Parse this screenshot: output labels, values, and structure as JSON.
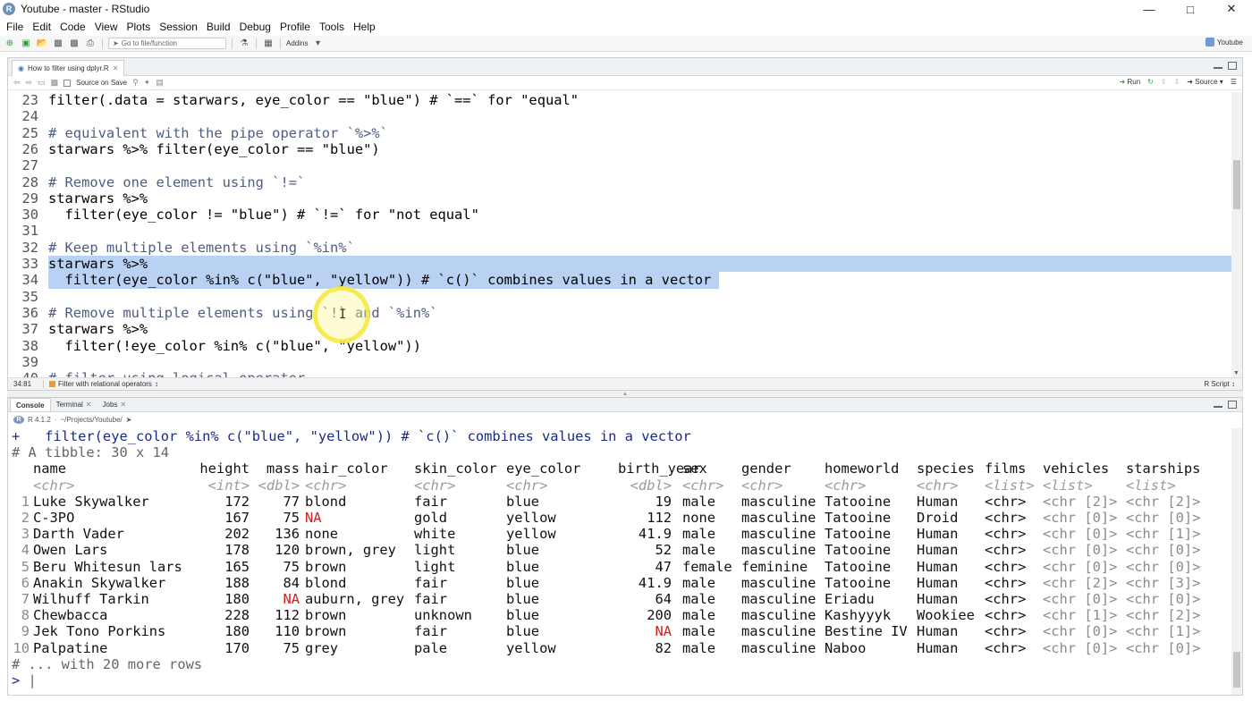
{
  "window": {
    "title": "Youtube - master - RStudio",
    "app_icon": "R"
  },
  "menu": [
    "File",
    "Edit",
    "Code",
    "View",
    "Plots",
    "Session",
    "Build",
    "Debug",
    "Profile",
    "Tools",
    "Help"
  ],
  "toolbar": {
    "goto_placeholder": "Go to file/function",
    "addins_label": "Addins",
    "project_label": "Youtube"
  },
  "editor": {
    "tab_label": "How to filter using dplyr.R",
    "source_on_save": "Source on Save",
    "run_label": "Run",
    "source_label": "Source",
    "status_position": "34:81",
    "status_section": "Filter with relational operators",
    "status_type": "R Script",
    "lines": [
      {
        "no": "23",
        "text": "filter(.data = starwars, eye_color == \"blue\") # `==` for \"equal\"",
        "kind": "code",
        "sel": false
      },
      {
        "no": "24",
        "text": "",
        "kind": "code",
        "sel": false
      },
      {
        "no": "25",
        "text": "# equivalent with the pipe operator `%>%`",
        "kind": "comment",
        "sel": false
      },
      {
        "no": "26",
        "text": "starwars %>% filter(eye_color == \"blue\")",
        "kind": "code",
        "sel": false
      },
      {
        "no": "27",
        "text": "",
        "kind": "code",
        "sel": false
      },
      {
        "no": "28",
        "text": "# Remove one element using `!=`",
        "kind": "comment",
        "sel": false
      },
      {
        "no": "29",
        "text": "starwars %>%",
        "kind": "code",
        "sel": false
      },
      {
        "no": "30",
        "text": "  filter(eye_color != \"blue\") # `!=` for \"not equal\"",
        "kind": "code",
        "sel": false
      },
      {
        "no": "31",
        "text": "",
        "kind": "code",
        "sel": false
      },
      {
        "no": "32",
        "text": "# Keep multiple elements using `%in%`",
        "kind": "comment",
        "sel": false
      },
      {
        "no": "33",
        "text": "starwars %>%",
        "kind": "code",
        "sel": true
      },
      {
        "no": "34",
        "text": "  filter(eye_color %in% c(\"blue\", \"yellow\")) # `c()` combines values in a vector",
        "kind": "code",
        "sel": true
      },
      {
        "no": "35",
        "text": "",
        "kind": "code",
        "sel": false
      },
      {
        "no": "36",
        "text": "# Remove multiple elements using `!` and `%in%`",
        "kind": "comment",
        "sel": false
      },
      {
        "no": "37",
        "text": "starwars %>%",
        "kind": "code",
        "sel": false
      },
      {
        "no": "38",
        "text": "  filter(!eye_color %in% c(\"blue\", \"yellow\"))",
        "kind": "code",
        "sel": false
      },
      {
        "no": "39",
        "text": "",
        "kind": "code",
        "sel": false
      },
      {
        "no": "40",
        "text": "# filter using logical operator",
        "kind": "comment",
        "sel": false
      }
    ]
  },
  "console": {
    "tabs": [
      "Console",
      "Terminal",
      "Jobs"
    ],
    "r_version": "R 4.1.2",
    "path": "~/Projects/Youtube/",
    "command_line": "+   filter(eye_color %in% c(\"blue\", \"yellow\")) # `c()` combines values in a vector",
    "tibble_header": "# A tibble: 30 x 14",
    "columns": [
      "name",
      "height",
      "mass",
      "hair_color",
      "skin_color",
      "eye_color",
      "birth_year",
      "sex",
      "gender",
      "homeworld",
      "species",
      "films",
      "vehicles",
      "starships"
    ],
    "types": [
      "<chr>",
      "<int>",
      "<dbl>",
      "<chr>",
      "<chr>",
      "<chr>",
      "<dbl>",
      "<chr>",
      "<chr>",
      "<chr>",
      "<chr>",
      "<list>",
      "<list>",
      "<list>"
    ],
    "rows": [
      [
        "1",
        "Luke Skywalker",
        "172",
        "77",
        "blond",
        "fair",
        "blue",
        "19",
        "male",
        "masculine",
        "Tatooine",
        "Human",
        "<chr>",
        "<chr [2]>",
        "<chr [2]>"
      ],
      [
        "2",
        "C-3PO",
        "167",
        "75",
        "NA",
        "gold",
        "yellow",
        "112",
        "none",
        "masculine",
        "Tatooine",
        "Droid",
        "<chr>",
        "<chr [0]>",
        "<chr [0]>"
      ],
      [
        "3",
        "Darth Vader",
        "202",
        "136",
        "none",
        "white",
        "yellow",
        "41.9",
        "male",
        "masculine",
        "Tatooine",
        "Human",
        "<chr>",
        "<chr [0]>",
        "<chr [1]>"
      ],
      [
        "4",
        "Owen Lars",
        "178",
        "120",
        "brown, grey",
        "light",
        "blue",
        "52",
        "male",
        "masculine",
        "Tatooine",
        "Human",
        "<chr>",
        "<chr [0]>",
        "<chr [0]>"
      ],
      [
        "5",
        "Beru Whitesun lars",
        "165",
        "75",
        "brown",
        "light",
        "blue",
        "47",
        "female",
        "feminine",
        "Tatooine",
        "Human",
        "<chr>",
        "<chr [0]>",
        "<chr [0]>"
      ],
      [
        "6",
        "Anakin Skywalker",
        "188",
        "84",
        "blond",
        "fair",
        "blue",
        "41.9",
        "male",
        "masculine",
        "Tatooine",
        "Human",
        "<chr>",
        "<chr [2]>",
        "<chr [3]>"
      ],
      [
        "7",
        "Wilhuff Tarkin",
        "180",
        "NA",
        "auburn, grey",
        "fair",
        "blue",
        "64",
        "male",
        "masculine",
        "Eriadu",
        "Human",
        "<chr>",
        "<chr [0]>",
        "<chr [0]>"
      ],
      [
        "8",
        "Chewbacca",
        "228",
        "112",
        "brown",
        "unknown",
        "blue",
        "200",
        "male",
        "masculine",
        "Kashyyyk",
        "Wookiee",
        "<chr>",
        "<chr [1]>",
        "<chr [2]>"
      ],
      [
        "9",
        "Jek Tono Porkins",
        "180",
        "110",
        "brown",
        "fair",
        "blue",
        "NA",
        "male",
        "masculine",
        "Bestine IV",
        "Human",
        "<chr>",
        "<chr [0]>",
        "<chr [1]>"
      ],
      [
        "10",
        "Palpatine",
        "170",
        "75",
        "grey",
        "pale",
        "yellow",
        "82",
        "male",
        "masculine",
        "Naboo",
        "Human",
        "<chr>",
        "<chr [0]>",
        "<chr [0]>"
      ]
    ],
    "more_rows": "# ... with 20 more rows",
    "prompt": ">"
  },
  "colors": {
    "selection": "#b9d1f3",
    "na": "#d02020",
    "command": "#1a2a8a",
    "comment": "#4d5e80"
  }
}
